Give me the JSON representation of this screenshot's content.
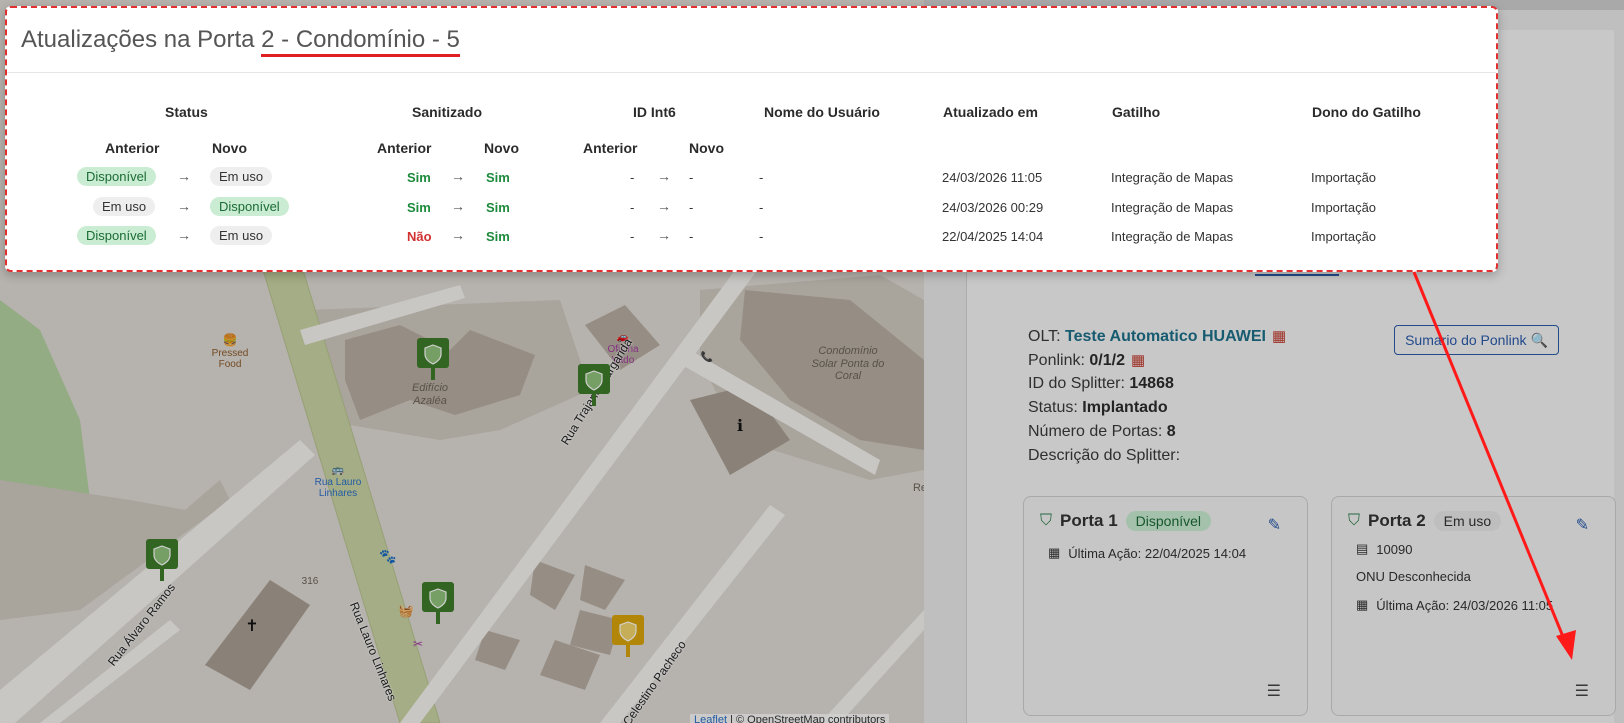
{
  "modal": {
    "title_prefix": "Atualizações na Porta ",
    "title_highlight": "2 - Condomínio - 5",
    "headers": {
      "status": "Status",
      "sanitizado": "Sanitizado",
      "id_int6": "ID Int6",
      "nome_usuario": "Nome do Usuário",
      "atualizado_em": "Atualizado em",
      "gatilho": "Gatilho",
      "dono_gatilho": "Dono do Gatilho",
      "anterior": "Anterior",
      "novo": "Novo"
    },
    "rows": [
      {
        "status_anterior": "Disponível",
        "status_novo": "Em uso",
        "san_anterior": "Sim",
        "san_novo": "Sim",
        "id_anterior": "-",
        "id_novo": "-",
        "usuario": "-",
        "atualizado": "24/03/2026 11:05",
        "gatilho": "Integração de Mapas",
        "dono": "Importação"
      },
      {
        "status_anterior": "Em uso",
        "status_novo": "Disponível",
        "san_anterior": "Sim",
        "san_novo": "Sim",
        "id_anterior": "-",
        "id_novo": "-",
        "usuario": "-",
        "atualizado": "24/03/2026 00:29",
        "gatilho": "Integração de Mapas",
        "dono": "Importação"
      },
      {
        "status_anterior": "Disponível",
        "status_novo": "Em uso",
        "san_anterior": "Não",
        "san_novo": "Sim",
        "id_anterior": "-",
        "id_novo": "-",
        "usuario": "-",
        "atualizado": "22/04/2025 14:04",
        "gatilho": "Integração de Mapas",
        "dono": "Importação"
      }
    ]
  },
  "map": {
    "labels": {
      "pressed_food": "Pressed Food",
      "edificio": "Edifício Azaléa",
      "oficina": "Oficina Vado",
      "condominio": "Condomínio Solar Ponta do Coral",
      "rua_trajano": "Rua Trajano Margarida",
      "rua_lauro_stop": "Rua Lauro Linhares",
      "rua_lauro": "Rua Lauro Linhares",
      "rua_alvaro": "Rua Álvaro Ramos",
      "celestino": "Celestino Pacheco",
      "num_316": "316",
      "re": "Re"
    },
    "attribution_leaflet": "Leaflet",
    "attribution_rest": " | © OpenStreetMap contributors"
  },
  "panel": {
    "olt_label": "OLT: ",
    "olt_value": "Teste Automatico HUAWEI",
    "ponlink_label": "Ponlink: ",
    "ponlink_value": "0/1/2",
    "splitter_id_label": "ID do Splitter: ",
    "splitter_id_value": "14868",
    "status_label": "Status: ",
    "status_value": "Implantado",
    "ports_count_label": "Número de Portas: ",
    "ports_count_value": "8",
    "description_label": "Descrição do Splitter:",
    "summary_button": "Sumario do Ponlink",
    "ports": [
      {
        "title": "Porta 1",
        "badge": "Disponível",
        "last_action": "Última Ação: 22/04/2025 14:04"
      },
      {
        "title": "Porta 2",
        "badge": "Em uso",
        "client_id": "10090",
        "onu": "ONU Desconhecida",
        "last_action": "Última Ação: 24/03/2026 11:05"
      }
    ]
  },
  "colors": {
    "accent": "#2b5bab",
    "annotation": "#e02020",
    "sim": "#1d8a3c",
    "nao": "#d23030",
    "marker_green": "#3d7a2a",
    "marker_yellow": "#d9a50c"
  }
}
